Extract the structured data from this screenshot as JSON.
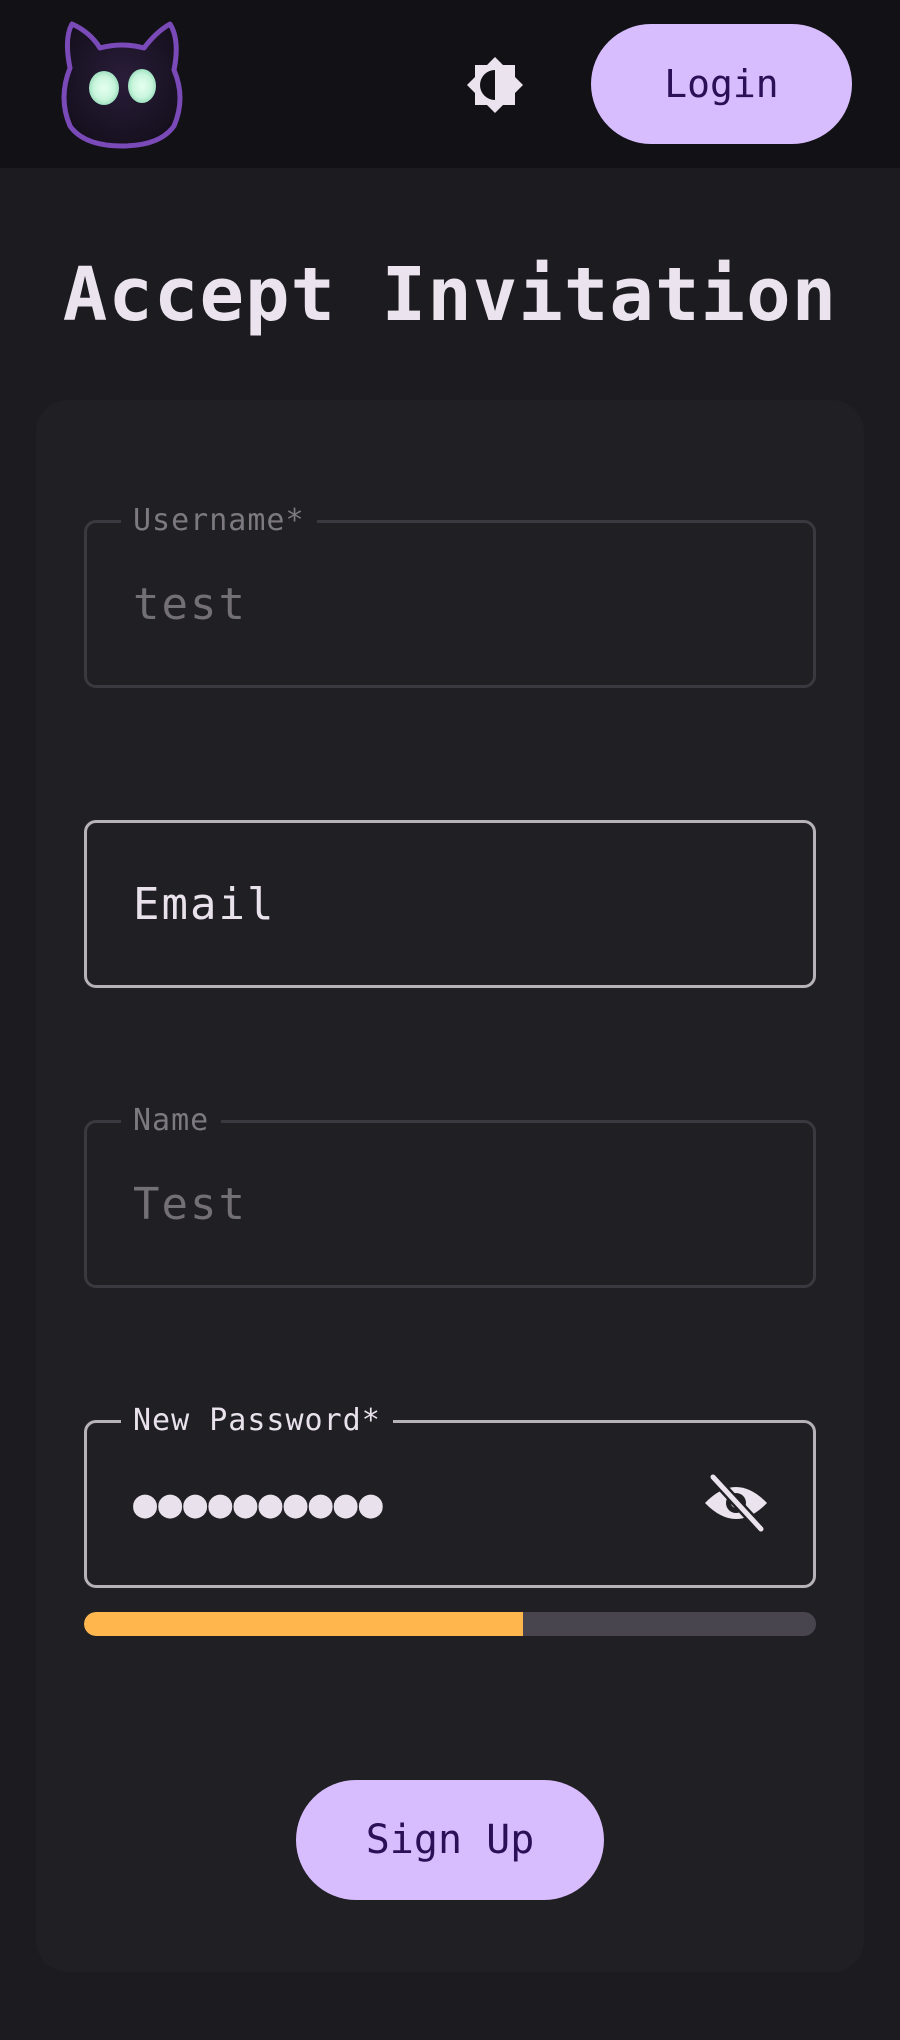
{
  "header": {
    "logo_icon": "cat-face-icon",
    "theme_icon": "contrast-brightness-icon",
    "login_label": "Login"
  },
  "page": {
    "title": "Accept Invitation"
  },
  "form": {
    "username": {
      "label": "Username*",
      "value": "test",
      "disabled": true
    },
    "email": {
      "label": "Email",
      "value": ""
    },
    "name": {
      "label": "Name",
      "value": "Test",
      "disabled": true
    },
    "password": {
      "label": "New Password*",
      "masked_value": "●●●●●●●●●●",
      "visibility_icon": "eye-off-icon",
      "strength_fraction": 0.6,
      "strength_color": "#ffb74d"
    },
    "submit_label": "Sign Up"
  },
  "colors": {
    "accent": "#d7bdfd",
    "accent_text": "#2b0f57",
    "background": "#1c1b20",
    "card": "#201f24",
    "topbar": "#121116"
  }
}
